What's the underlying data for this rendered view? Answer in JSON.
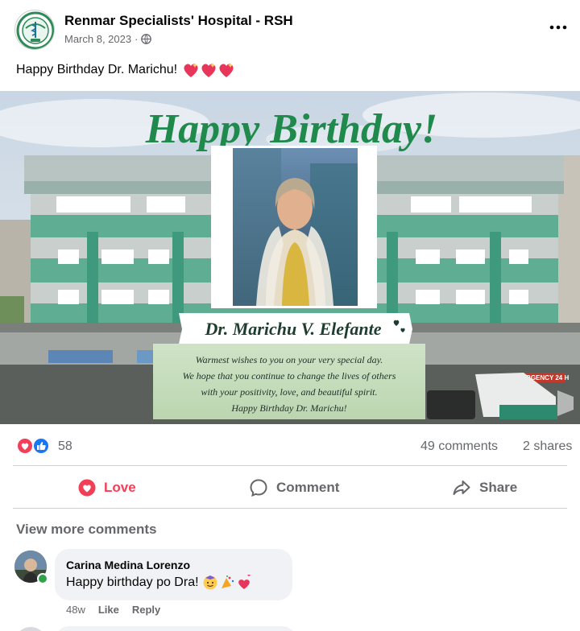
{
  "post": {
    "page_name": "Renmar Specialists' Hospital - RSH",
    "date": "March 8, 2023",
    "date_separator": "·",
    "text": "Happy Birthday Dr. Marichu!"
  },
  "image": {
    "headline": "Happy Birthday!",
    "doctor_name": "Dr. Marichu V. Elefante",
    "message_lines": [
      "Warmest wishes to you on your very special day.",
      "We hope that you continue to change the lives of others",
      "with your positivity, love, and beautiful spirit.",
      "Happy Birthday Dr. Marichu!"
    ],
    "building_sign": "EMERGENCY 24 H",
    "colors": {
      "headline_green": "#1f8a4c",
      "card_green": "#c7dcbf",
      "building_green": "#4ba88c"
    }
  },
  "stats": {
    "reaction_count": "58",
    "comments": "49 comments",
    "shares": "2 shares",
    "reaction_icons": [
      "love-reaction-icon",
      "like-reaction-icon"
    ]
  },
  "actions": {
    "love": "Love",
    "comment": "Comment",
    "share": "Share"
  },
  "comments_section": {
    "view_more": "View more comments",
    "comments": [
      {
        "name": "Carina Medina Lorenzo",
        "text": "Happy birthday po Dra!",
        "time": "48w",
        "like": "Like",
        "reply": "Reply"
      }
    ]
  },
  "colors": {
    "love_red": "#f33e58",
    "like_blue": "#1877f2",
    "meta_gray": "#65676b"
  }
}
